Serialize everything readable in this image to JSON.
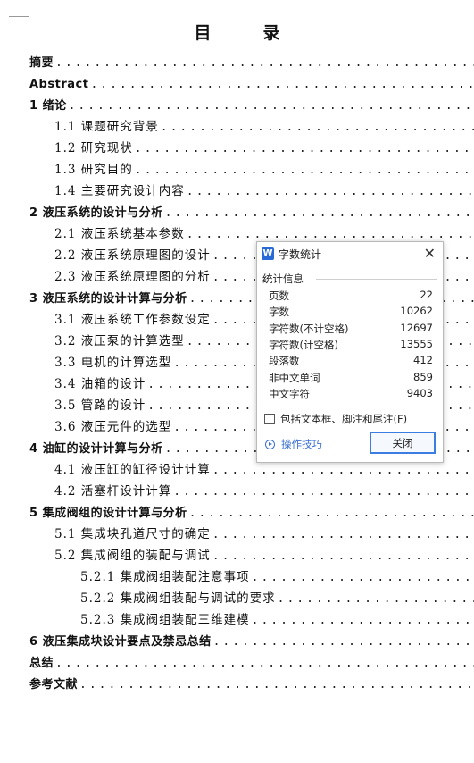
{
  "document": {
    "title": "目录",
    "toc": [
      {
        "text": "摘要",
        "level": 1
      },
      {
        "text": "Abstract",
        "level": 1
      },
      {
        "text": "1 绪论",
        "level": 1
      },
      {
        "text": "1.1 课题研究背景",
        "level": 2
      },
      {
        "text": "1.2 研究现状",
        "level": 2
      },
      {
        "text": "1.3 研究目的",
        "level": 2
      },
      {
        "text": "1.4 主要研究设计内容",
        "level": 2
      },
      {
        "text": "2 液压系统的设计与分析",
        "level": 1
      },
      {
        "text": "2.1 液压系统基本参数",
        "level": 2
      },
      {
        "text": "2.2 液压系统原理图的设计",
        "level": 2
      },
      {
        "text": "2.3 液压系统原理图的分析",
        "level": 2
      },
      {
        "text": "3 液压系统的设计计算与分析",
        "level": 1
      },
      {
        "text": "3.1 液压系统工作参数设定",
        "level": 2
      },
      {
        "text": "3.2 液压泵的计算选型",
        "level": 2
      },
      {
        "text": "3.3 电机的计算选型",
        "level": 2
      },
      {
        "text": "3.4 油箱的设计",
        "level": 2
      },
      {
        "text": "3.5 管路的设计",
        "level": 2
      },
      {
        "text": "3.6 液压元件的选型",
        "level": 2
      },
      {
        "text": "4 油缸的设计计算与分析",
        "level": 1
      },
      {
        "text": "4.1 液压缸的缸径设计计算",
        "level": 2
      },
      {
        "text": "4.2 活塞杆设计计算",
        "level": 2
      },
      {
        "text": "5 集成阀组的设计计算与分析",
        "level": 1
      },
      {
        "text": "5.1 集成块孔道尺寸的确定",
        "level": 2
      },
      {
        "text": "5.2 集成阀组的装配与调试",
        "level": 2
      },
      {
        "text": "5.2.1 集成阀组装配注意事项",
        "level": 3
      },
      {
        "text": "5.2.2 集成阀组装配与调试的要求",
        "level": 3
      },
      {
        "text": "5.2.3 集成阀组装配三维建模",
        "level": 3
      },
      {
        "text": "6 液压集成块设计要点及禁忌总结",
        "level": 1
      },
      {
        "text": "总结",
        "level": 1
      },
      {
        "text": "参考文献",
        "level": 1
      }
    ]
  },
  "dialog": {
    "title": "字数统计",
    "section_label": "统计信息",
    "stats": [
      {
        "label": "页数",
        "value": "22"
      },
      {
        "label": "字数",
        "value": "10262"
      },
      {
        "label": "字符数(不计空格)",
        "value": "12697"
      },
      {
        "label": "字符数(计空格)",
        "value": "13555"
      },
      {
        "label": "段落数",
        "value": "412"
      },
      {
        "label": "非中文单词",
        "value": "859"
      },
      {
        "label": "中文字符",
        "value": "9403"
      }
    ],
    "checkbox_label": "包括文本框、脚注和尾注(F)",
    "checkbox_checked": false,
    "tips_label": "操作技巧",
    "close_button": "关闭",
    "app_icon": "W"
  }
}
